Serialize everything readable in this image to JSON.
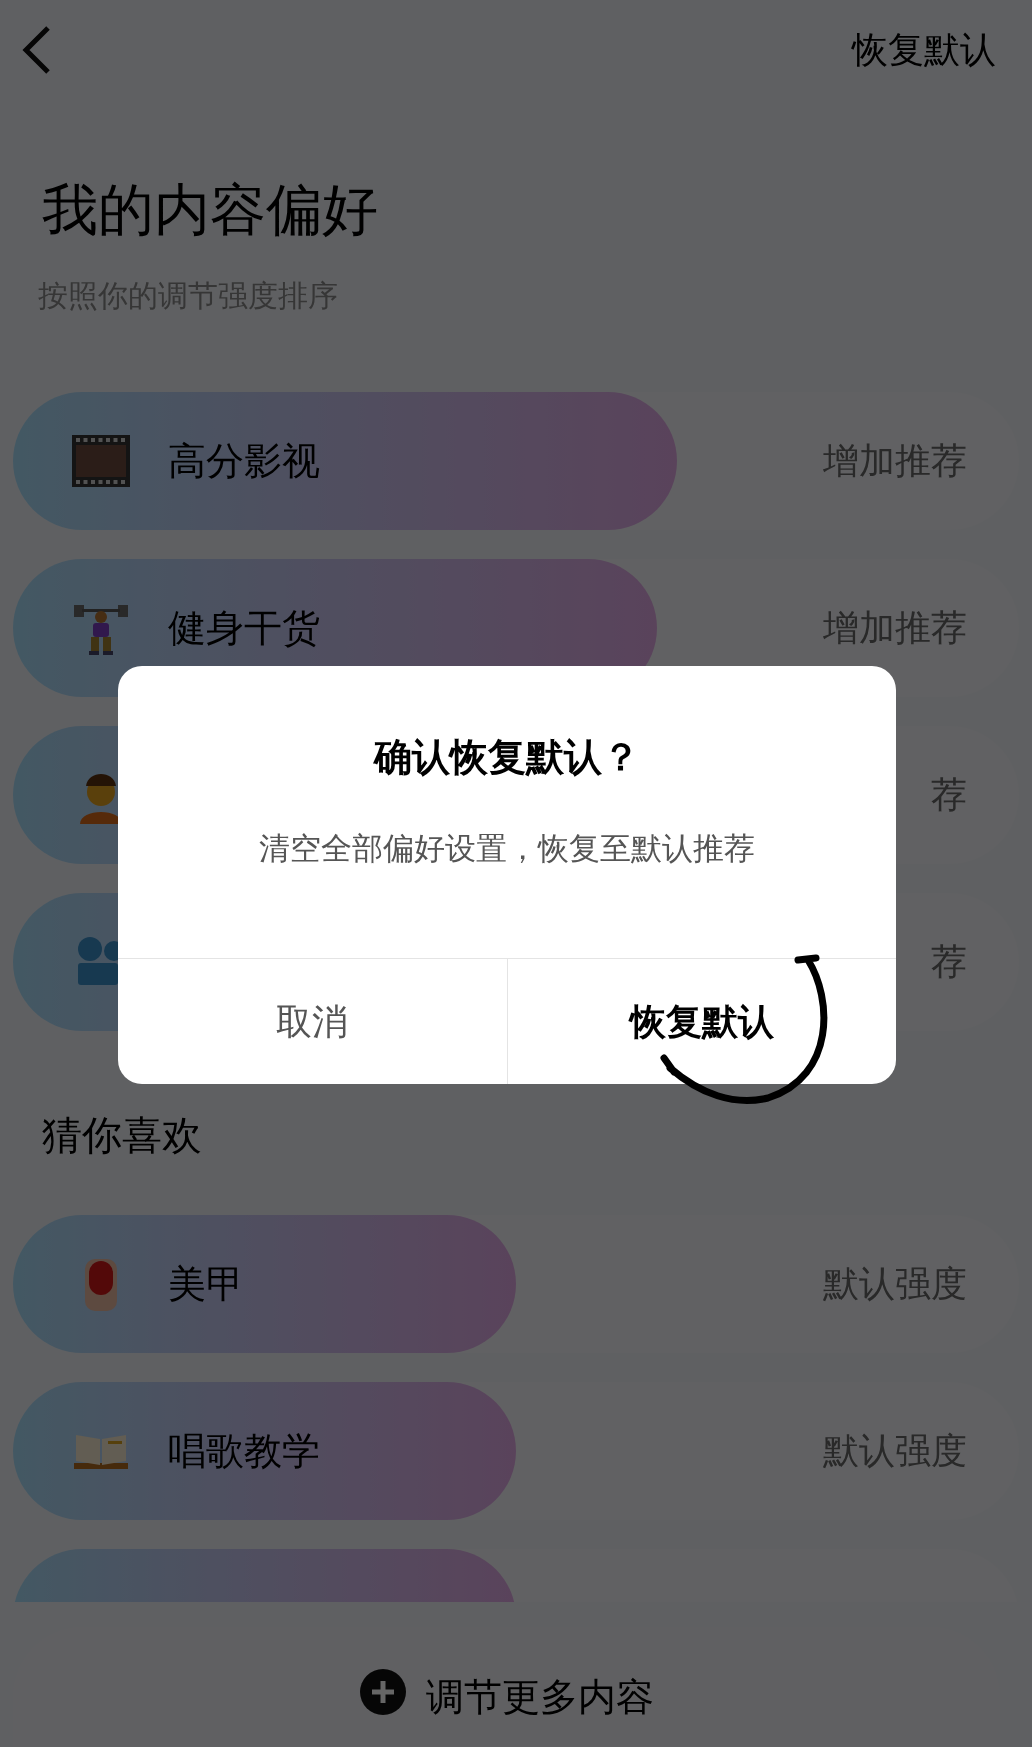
{
  "header": {
    "reset_link": "恢复默认"
  },
  "title": "我的内容偏好",
  "subtitle": "按照你的调节强度排序",
  "preferences": [
    {
      "kind": "film",
      "label": "高分影视",
      "action": "增加推荐",
      "level": 0.66
    },
    {
      "kind": "weightlifter",
      "label": "健身干货",
      "action": "增加推荐",
      "level": 0.64
    },
    {
      "kind": "person",
      "action": "荐",
      "level": 0.6
    },
    {
      "kind": "camera",
      "action": "荐",
      "level": 0.6
    }
  ],
  "suggestions_title": "猜你喜欢",
  "suggestions": [
    {
      "kind": "nail",
      "label": "美甲",
      "action": "默认强度",
      "level": 0.5
    },
    {
      "kind": "book",
      "label": "唱歌教学",
      "action": "默认强度",
      "level": 0.5
    },
    {
      "kind": "blank",
      "level": 0.5
    }
  ],
  "more_button": "调节更多内容",
  "dialog": {
    "title": "确认恢复默认？",
    "message": "清空全部偏好设置，恢复至默认推荐",
    "cancel": "取消",
    "confirm": "恢复默认"
  }
}
